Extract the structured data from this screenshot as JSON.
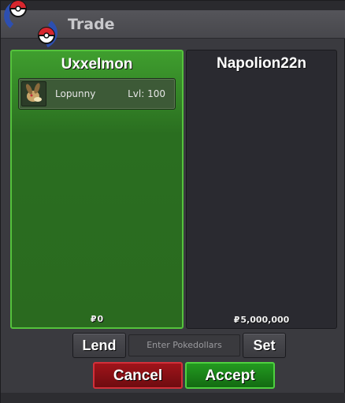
{
  "window": {
    "title": "Trade"
  },
  "left_panel": {
    "player_name": "Uxxelmon",
    "money": "0",
    "pokemon": [
      {
        "name": "Lopunny",
        "level": "Lvl: 100"
      }
    ]
  },
  "right_panel": {
    "player_name": "Napolion22n",
    "money": "5,000,000"
  },
  "currency_symbol": "₽",
  "controls": {
    "lend_label": "Lend",
    "money_placeholder": "Enter Pokedollars",
    "set_label": "Set",
    "cancel_label": "Cancel",
    "accept_label": "Accept"
  },
  "colors": {
    "left_panel_accent": "#54c23c",
    "cancel": "#a0141a",
    "accept": "#239a20"
  }
}
